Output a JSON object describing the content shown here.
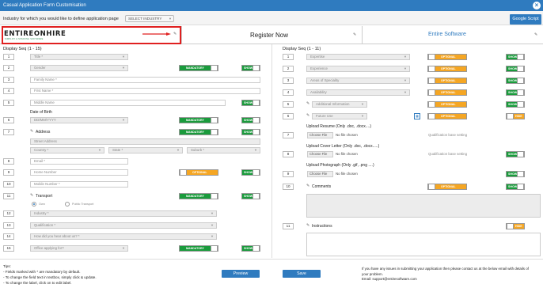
{
  "window": {
    "title": "Casual Application Form Customisation"
  },
  "industry": {
    "label": "Industry for which you would like to define application page",
    "select": "SELECT INDUSTRY"
  },
  "google_script": "Google Script",
  "header": {
    "logo_main": "ENTIREONHIRE",
    "logo_tag": "SIMPLIFY & STAFFING SOFTWARE",
    "register_now": "Register Now",
    "entire_software": "Entire Software"
  },
  "switch": {
    "mandatory": "MANDATORY",
    "optional": "OPTIONAL",
    "show": "SHOW",
    "hide": "HIDE"
  },
  "left": {
    "seq_title": "Display Seq (1 - 15)",
    "title_field": "Title *",
    "gender": "Gender",
    "family_name": "Family Name *",
    "first_name": "First Name *",
    "middle_name": "Middle Name",
    "dob_label": "Date of Birth",
    "dob_value": "DD/MM/YYYY",
    "address_label": "Address",
    "street": "Street Address",
    "country": "Country *",
    "state": "State *",
    "suburb": "Suburb *",
    "email": "Email *",
    "home_number": "Home Number",
    "mobile_number": "Mobile Number *",
    "transport_label": "Transport",
    "own": "Own",
    "public_transport": "Public Transport",
    "industry": "Industry *",
    "qualification": "Qualification *",
    "hear": "How did you hear about us? *",
    "office": "Office applying for?",
    "nums": [
      "1",
      "2",
      "3",
      "4",
      "5",
      "6",
      "7",
      "8",
      "9",
      "10",
      "11",
      "12",
      "13",
      "14",
      "15"
    ]
  },
  "right": {
    "seq_title": "Display Seq (1 - 11)",
    "expertise": "Expertise",
    "experience": "Experience",
    "areas": "Areas of Speciality",
    "availability": "Availability",
    "additional": "Additional Information",
    "future_use": "Future Use",
    "resume_label": "Upload Resume (Only .doc, .docx....)",
    "cover_label": "Upload Cover Letter (Only .doc, .docx.....)",
    "photo_label": "Upload Photograph (Only .gif, .png ....)",
    "choose_file": "Choose File",
    "no_file": "No file chosen",
    "qual_setting": "Qualification base setting",
    "comments": "Comments",
    "instructions": "Instructions",
    "nums": [
      "1",
      "2",
      "3",
      "4",
      "5",
      "6",
      "7",
      "8",
      "9",
      "10",
      "11"
    ]
  },
  "footer": {
    "tips_title": "Tips:",
    "tip1": "- Fields marked with * are mandatory by default.",
    "tip2": "- To change the field text in textbox, simply click & update.",
    "tip3": "- To change the label, click on  to edit label.",
    "preview": "Preview",
    "save": "Save",
    "help1": "If you have any issues in submitting your application then please contact us at the below email with details of",
    "help2": "your problem.",
    "help3": "Email: support@entiresoftware.com"
  },
  "colors": {
    "accent": "#2f7bbf",
    "mandatory": "#1a9b3c",
    "optional": "#f5a623",
    "highlight": "#e02020"
  }
}
